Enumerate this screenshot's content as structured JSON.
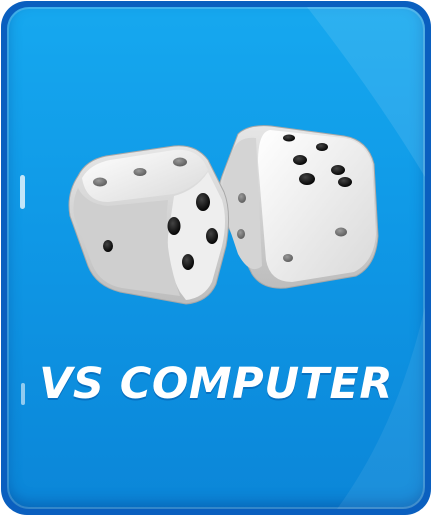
{
  "menu_option": {
    "label": "VS COMPUTER",
    "icon": "two-dice-icon",
    "colors": {
      "face_top": "#16a8ef",
      "face_bottom": "#0b86d8",
      "border": "#0a5fbf",
      "text": "#ffffff",
      "die": "#f2f2f2",
      "pip": "#111111"
    }
  }
}
